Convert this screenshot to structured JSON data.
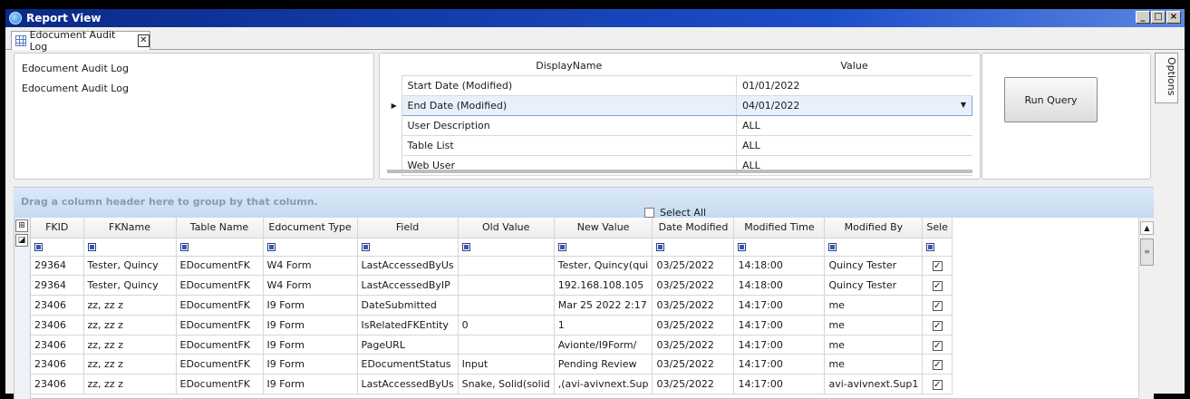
{
  "window": {
    "title": "Report View"
  },
  "tab": {
    "label": "Edocument Audit Log",
    "close": "✕"
  },
  "left_panel": {
    "line1": "Edocument Audit Log",
    "line2": "Edocument Audit Log"
  },
  "params": {
    "col_display": "DisplayName",
    "col_value": "Value",
    "rows": [
      {
        "name": "Start Date (Modified)",
        "value": "01/01/2022"
      },
      {
        "name": "End Date (Modified)",
        "value": "04/01/2022"
      },
      {
        "name": "User Description",
        "value": "ALL"
      },
      {
        "name": "Table List",
        "value": "ALL"
      },
      {
        "name": "Web User",
        "value": "ALL"
      }
    ]
  },
  "run_query_label": "Run Query",
  "options_label": "Options",
  "group_hint": "Drag a column header here to group by that column.",
  "select_all_label": "Select All",
  "grid": {
    "headers": [
      "FKID",
      "FKName",
      "Table Name",
      "Edocument Type",
      "Field",
      "Old Value",
      "New Value",
      "Date Modified",
      "Modified Time",
      "Modified By",
      "Sele"
    ],
    "rows": [
      [
        "29364",
        "Tester, Quincy",
        "EDocumentFK",
        "W4 Form",
        "LastAccessedByUs",
        "",
        "Tester, Quincy(qui",
        "03/25/2022",
        "14:18:00",
        "Quincy Tester"
      ],
      [
        "29364",
        "Tester, Quincy",
        "EDocumentFK",
        "W4 Form",
        "LastAccessedByIP",
        "",
        "192.168.108.105",
        "03/25/2022",
        "14:18:00",
        "Quincy Tester"
      ],
      [
        "23406",
        "zz, zz z",
        "EDocumentFK",
        "I9 Form",
        "DateSubmitted",
        "",
        "Mar 25 2022  2:17",
        "03/25/2022",
        "14:17:00",
        "me"
      ],
      [
        "23406",
        "zz, zz z",
        "EDocumentFK",
        "I9 Form",
        "IsRelatedFKEntity",
        "0",
        "1",
        "03/25/2022",
        "14:17:00",
        "me"
      ],
      [
        "23406",
        "zz, zz z",
        "EDocumentFK",
        "I9 Form",
        "PageURL",
        "",
        "Avionte/I9Form/",
        "03/25/2022",
        "14:17:00",
        "me"
      ],
      [
        "23406",
        "zz, zz z",
        "EDocumentFK",
        "I9 Form",
        "EDocumentStatus",
        "Input",
        "Pending Review",
        "03/25/2022",
        "14:17:00",
        "me"
      ],
      [
        "23406",
        "zz, zz z",
        "EDocumentFK",
        "I9 Form",
        "LastAccessedByUs",
        "Snake, Solid(solid",
        ",(avi-avivnext.Sup",
        "03/25/2022",
        "14:17:00",
        "avi-avivnext.Sup1"
      ]
    ]
  }
}
